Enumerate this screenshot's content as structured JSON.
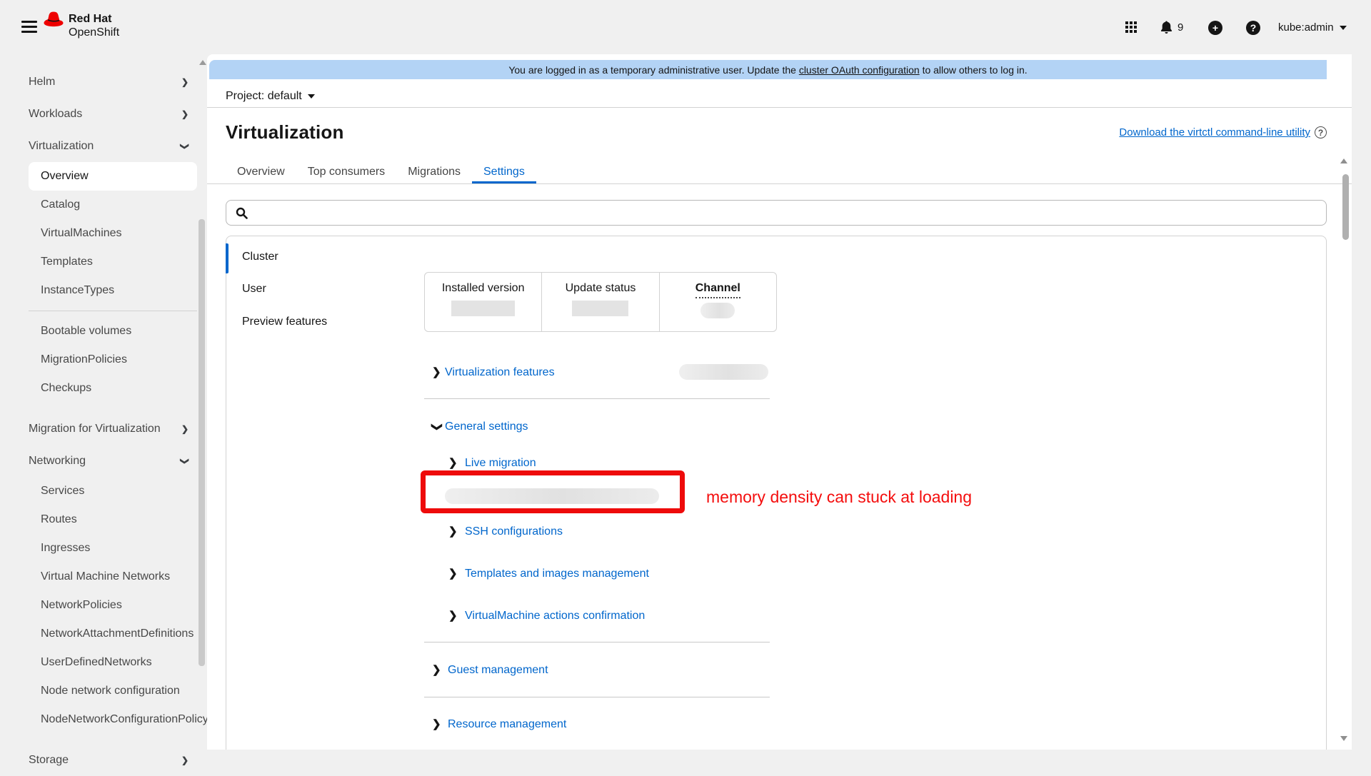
{
  "masthead": {
    "brand": "Red Hat",
    "product": "OpenShift",
    "notification_count": "9",
    "user": "kube:admin"
  },
  "banner": {
    "pre": "You are logged in as a temporary administrative user. Update the ",
    "link": "cluster OAuth configuration",
    "post": " to allow others to log in."
  },
  "project_bar": {
    "label": "Project: default"
  },
  "sidebar": {
    "items": [
      {
        "label": "Helm"
      },
      {
        "label": "Workloads"
      },
      {
        "label": "Virtualization"
      },
      {
        "label": "Overview"
      },
      {
        "label": "Catalog"
      },
      {
        "label": "VirtualMachines"
      },
      {
        "label": "Templates"
      },
      {
        "label": "InstanceTypes"
      },
      {
        "label": "Bootable volumes"
      },
      {
        "label": "MigrationPolicies"
      },
      {
        "label": "Checkups"
      },
      {
        "label": "Migration for Virtualization"
      },
      {
        "label": "Networking"
      },
      {
        "label": "Services"
      },
      {
        "label": "Routes"
      },
      {
        "label": "Ingresses"
      },
      {
        "label": "Virtual Machine Networks"
      },
      {
        "label": "NetworkPolicies"
      },
      {
        "label": "NetworkAttachmentDefinitions"
      },
      {
        "label": "UserDefinedNetworks"
      },
      {
        "label": "Node network configuration"
      },
      {
        "label": "NodeNetworkConfigurationPolicy"
      },
      {
        "label": "Storage"
      }
    ]
  },
  "page_header": {
    "title": "Virtualization",
    "download_link": "Download the virtctl command-line utility"
  },
  "tabs": [
    {
      "label": "Overview"
    },
    {
      "label": "Top consumers"
    },
    {
      "label": "Migrations"
    },
    {
      "label": "Settings"
    }
  ],
  "settings_nav": [
    {
      "label": "Cluster"
    },
    {
      "label": "User"
    },
    {
      "label": "Preview features"
    }
  ],
  "version_summary": {
    "columns": [
      {
        "label": "Installed version"
      },
      {
        "label": "Update status"
      },
      {
        "label": "Channel"
      }
    ]
  },
  "sections": {
    "virtualization_features": "Virtualization features",
    "general_settings": "General settings",
    "live_migration": "Live migration",
    "ssh_configurations": "SSH configurations",
    "templates_images": "Templates and images management",
    "vm_actions": "VirtualMachine actions confirmation",
    "guest_management": "Guest management",
    "resource_management": "Resource management"
  },
  "annotation": {
    "text": "memory density can stuck at loading"
  },
  "colors": {
    "accent": "#0066cc",
    "banner_bg": "#b3d3f5",
    "annotation_red": "#f40d0d",
    "highlight_red": "#ee0b0b",
    "chrome_bg": "#f0f0f0"
  }
}
